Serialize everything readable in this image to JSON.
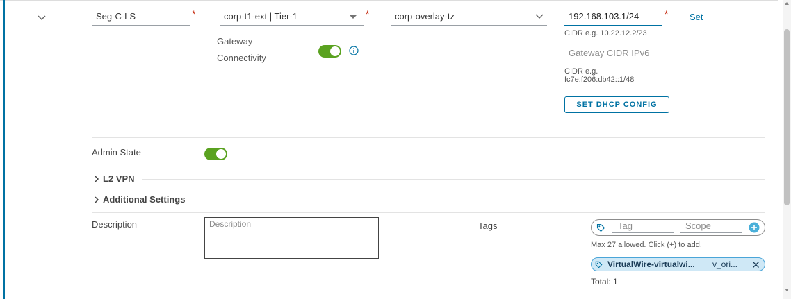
{
  "segment": {
    "name": "Seg-C-LS",
    "gateway": "corp-t1-ext | Tier-1",
    "transport_zone": "corp-overlay-tz",
    "subnet": "192.168.103.1/24",
    "required_mark": "*",
    "set_link": "Set",
    "cidr_hint_v4": "CIDR e.g. 10.22.12.2/23",
    "gateway_cidr_ipv6_placeholder": "Gateway CIDR IPv6",
    "cidr_hint_v6_line1": "CIDR e.g.",
    "cidr_hint_v6_line2": "fc7e:f206:db42::1/48",
    "dhcp_button": "SET DHCP CONFIG",
    "gateway_connectivity_line1": "Gateway",
    "gateway_connectivity_line2": "Connectivity"
  },
  "details": {
    "admin_state_label": "Admin State",
    "l2vpn_label": "L2 VPN",
    "additional_settings_label": "Additional Settings",
    "description_label": "Description",
    "description_placeholder": "Description",
    "tags_label": "Tags",
    "tag_placeholder": "Tag",
    "scope_placeholder": "Scope",
    "tags_hint": "Max 27 allowed. Click (+) to add.",
    "tag_chip_tag": "VirtualWire-virtualwi...",
    "tag_chip_scope": "v_ori...",
    "total": "Total: 1"
  },
  "colors": {
    "accent": "#0072a3",
    "toggle_on": "#5aa220",
    "required": "#c21d00"
  }
}
